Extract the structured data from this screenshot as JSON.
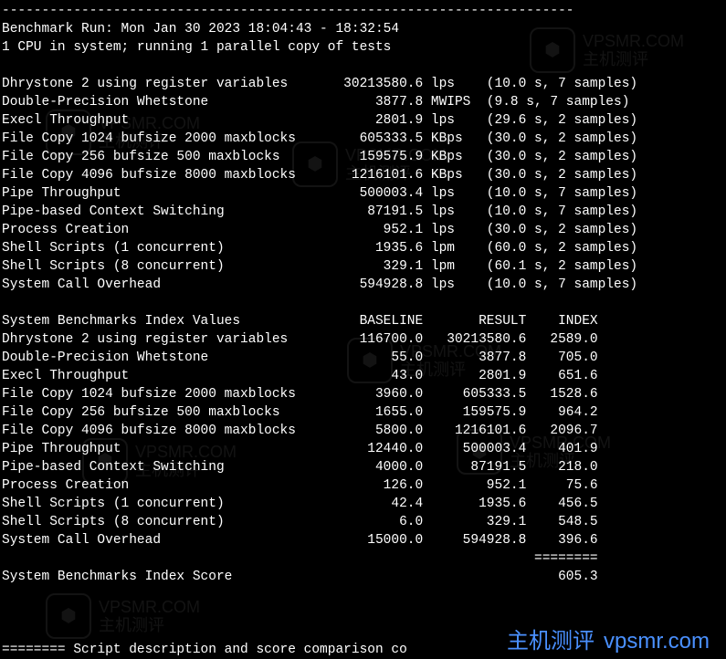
{
  "header": {
    "dashes_top": "------------------------------------------------------------------------",
    "run_line": "Benchmark Run: Mon Jan 30 2023 18:04:43 - 18:32:54",
    "cpu_line": "1 CPU in system; running 1 parallel copy of tests"
  },
  "results": [
    {
      "name": "Dhrystone 2 using register variables",
      "value": "30213580.6",
      "unit": "lps",
      "time": "10.0 s",
      "samples": "7 samples"
    },
    {
      "name": "Double-Precision Whetstone",
      "value": "3877.8",
      "unit": "MWIPS",
      "time": "9.8 s",
      "samples": "7 samples"
    },
    {
      "name": "Execl Throughput",
      "value": "2801.9",
      "unit": "lps",
      "time": "29.6 s",
      "samples": "2 samples"
    },
    {
      "name": "File Copy 1024 bufsize 2000 maxblocks",
      "value": "605333.5",
      "unit": "KBps",
      "time": "30.0 s",
      "samples": "2 samples"
    },
    {
      "name": "File Copy 256 bufsize 500 maxblocks",
      "value": "159575.9",
      "unit": "KBps",
      "time": "30.0 s",
      "samples": "2 samples"
    },
    {
      "name": "File Copy 4096 bufsize 8000 maxblocks",
      "value": "1216101.6",
      "unit": "KBps",
      "time": "30.0 s",
      "samples": "2 samples"
    },
    {
      "name": "Pipe Throughput",
      "value": "500003.4",
      "unit": "lps",
      "time": "10.0 s",
      "samples": "7 samples"
    },
    {
      "name": "Pipe-based Context Switching",
      "value": "87191.5",
      "unit": "lps",
      "time": "10.0 s",
      "samples": "7 samples"
    },
    {
      "name": "Process Creation",
      "value": "952.1",
      "unit": "lps",
      "time": "30.0 s",
      "samples": "2 samples"
    },
    {
      "name": "Shell Scripts (1 concurrent)",
      "value": "1935.6",
      "unit": "lpm",
      "time": "60.0 s",
      "samples": "2 samples"
    },
    {
      "name": "Shell Scripts (8 concurrent)",
      "value": "329.1",
      "unit": "lpm",
      "time": "60.1 s",
      "samples": "2 samples"
    },
    {
      "name": "System Call Overhead",
      "value": "594928.8",
      "unit": "lps",
      "time": "10.0 s",
      "samples": "7 samples"
    }
  ],
  "index_header": {
    "title": "System Benchmarks Index Values",
    "col_baseline": "BASELINE",
    "col_result": "RESULT",
    "col_index": "INDEX"
  },
  "index_rows": [
    {
      "name": "Dhrystone 2 using register variables",
      "baseline": "116700.0",
      "result": "30213580.6",
      "index": "2589.0"
    },
    {
      "name": "Double-Precision Whetstone",
      "baseline": "55.0",
      "result": "3877.8",
      "index": "705.0"
    },
    {
      "name": "Execl Throughput",
      "baseline": "43.0",
      "result": "2801.9",
      "index": "651.6"
    },
    {
      "name": "File Copy 1024 bufsize 2000 maxblocks",
      "baseline": "3960.0",
      "result": "605333.5",
      "index": "1528.6"
    },
    {
      "name": "File Copy 256 bufsize 500 maxblocks",
      "baseline": "1655.0",
      "result": "159575.9",
      "index": "964.2"
    },
    {
      "name": "File Copy 4096 bufsize 8000 maxblocks",
      "baseline": "5800.0",
      "result": "1216101.6",
      "index": "2096.7"
    },
    {
      "name": "Pipe Throughput",
      "baseline": "12440.0",
      "result": "500003.4",
      "index": "401.9"
    },
    {
      "name": "Pipe-based Context Switching",
      "baseline": "4000.0",
      "result": "87191.5",
      "index": "218.0"
    },
    {
      "name": "Process Creation",
      "baseline": "126.0",
      "result": "952.1",
      "index": "75.6"
    },
    {
      "name": "Shell Scripts (1 concurrent)",
      "baseline": "42.4",
      "result": "1935.6",
      "index": "456.5"
    },
    {
      "name": "Shell Scripts (8 concurrent)",
      "baseline": "6.0",
      "result": "329.1",
      "index": "548.5"
    },
    {
      "name": "System Call Overhead",
      "baseline": "15000.0",
      "result": "594928.8",
      "index": "396.6"
    }
  ],
  "score": {
    "divider": "========",
    "label": "System Benchmarks Index Score",
    "value": "605.3"
  },
  "footer": {
    "dashes": "======== Script description and score comparison co",
    "brand_cn": "主机测评",
    "brand_url": "vpsmr.com"
  },
  "watermark": {
    "text_cn": "主机测评",
    "text_url": "VPSMR.COM"
  }
}
